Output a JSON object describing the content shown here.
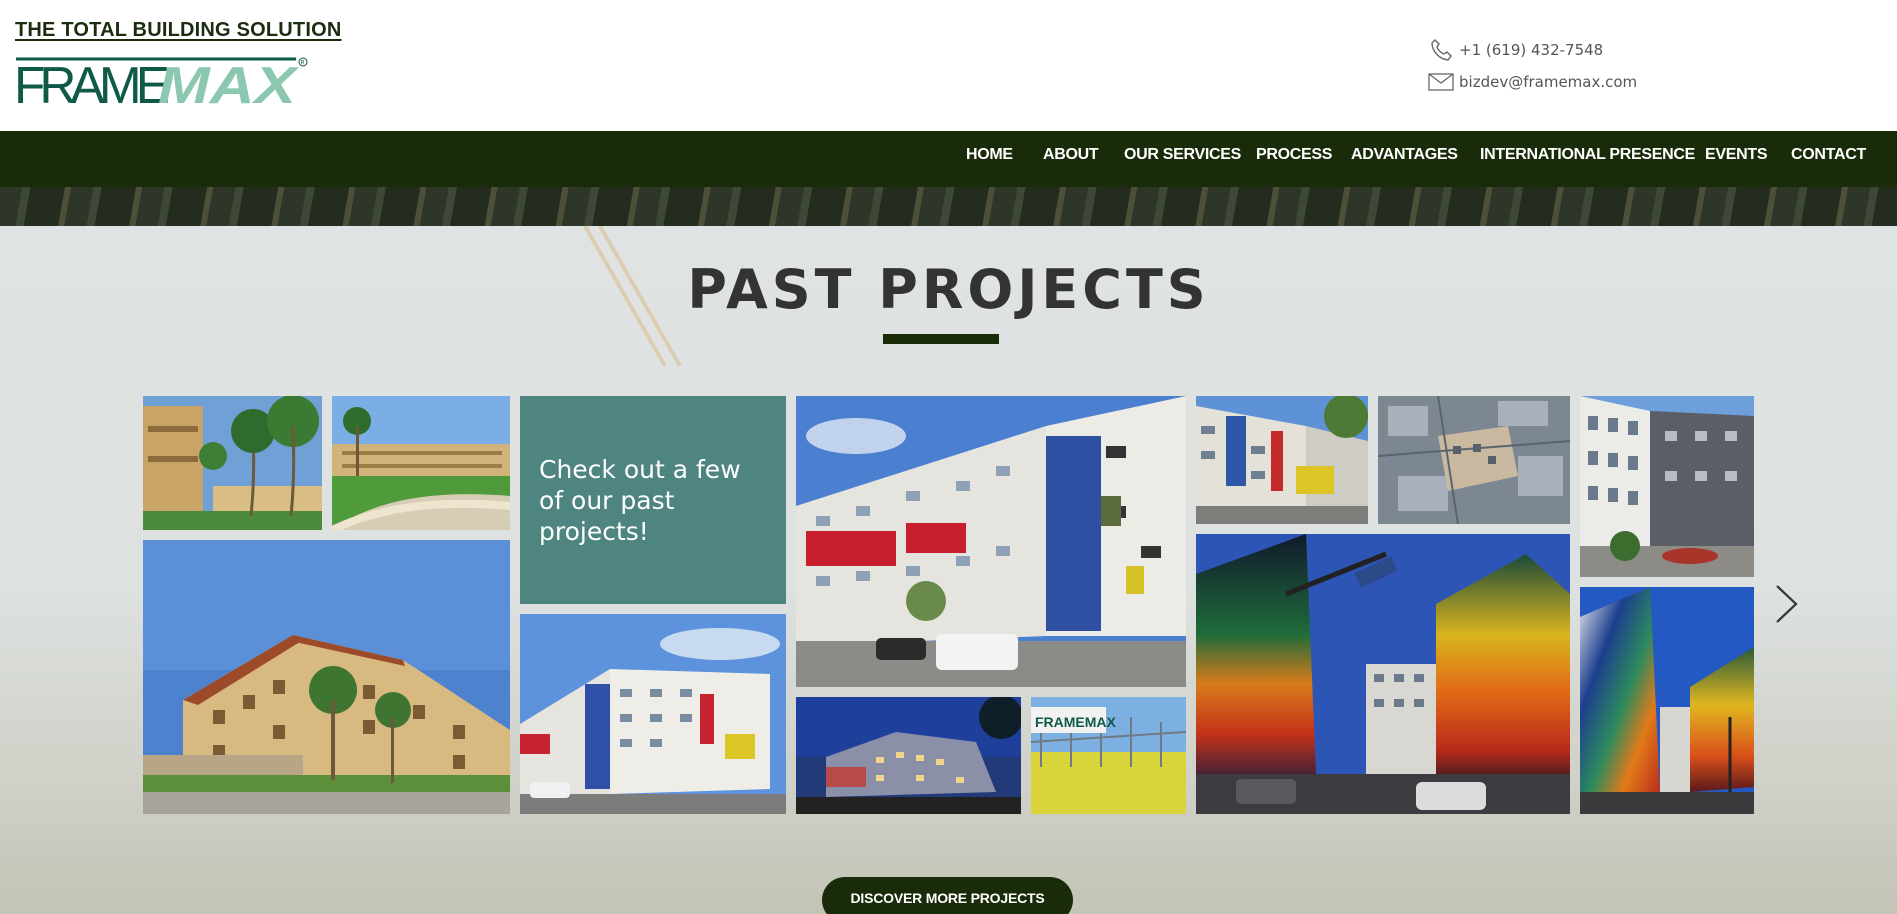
{
  "header": {
    "tagline": "THE TOTAL BUILDING SOLUTION",
    "logo_text_part1": "FRAME",
    "logo_text_part2": "MAX",
    "phone": "+1 (619) 432-7548",
    "email": "bizdev@framemax.com",
    "phone_icon": "phone-icon",
    "email_icon": "envelope-icon"
  },
  "nav": {
    "items": [
      {
        "label": "HOME"
      },
      {
        "label": "ABOUT"
      },
      {
        "label": "OUR SERVICES"
      },
      {
        "label": "PROCESS"
      },
      {
        "label": "ADVANTAGES"
      },
      {
        "label": "INTERNATIONAL PRESENCE"
      },
      {
        "label": "EVENTS"
      },
      {
        "label": "CONTACT"
      }
    ]
  },
  "projects": {
    "title": "PAST PROJECTS",
    "promo_text": "Check out a few of our past projects!",
    "cta_label": "DISCOVER MORE PROJECTS",
    "next_icon": "chevron-right-icon",
    "photo_sign_text": "FRAMEMAX"
  },
  "colors": {
    "brand_dark_green": "#1a2b0a",
    "logo_green": "#0e5a47",
    "logo_light": "#8cc7b0",
    "promo_teal": "#4e8580"
  }
}
